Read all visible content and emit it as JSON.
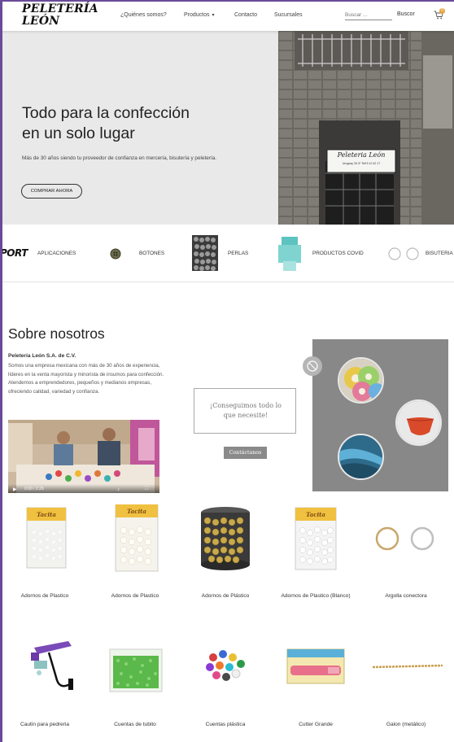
{
  "header": {
    "logo_line1": "PELETERÍA",
    "logo_line2": "LEÓN",
    "nav": {
      "about": "¿Quiénes somos?",
      "products": "Productos",
      "contact": "Contacto",
      "branches": "Sucursales"
    },
    "search": {
      "placeholder": "Buscar ...",
      "button": "Buscor"
    },
    "cart_count": "0"
  },
  "hero": {
    "title_line1": "Todo para la confección",
    "title_line2": "en un solo lugar",
    "subtitle": "Más de 30 años siendo tu proveedor de confianza en mercería, bisutería y peletería.",
    "cta": "COMPRAR AHORA",
    "sign_line1": "Peleteria León",
    "sign_line2": "Uruguay 30-3º Telf 5 10 42 17"
  },
  "categories": [
    {
      "label": "APLICACIONES",
      "badge_text": "PORT"
    },
    {
      "label": "BOTONES"
    },
    {
      "label": "PERLAS"
    },
    {
      "label": "PRODUCTOS COVID"
    },
    {
      "label": "BISUTERIA"
    }
  ],
  "about": {
    "title": "Sobre nosotros",
    "company": "Peletería León S.A. de C.V.",
    "text": "Somos una empresa mexicana con más de 30 años de experiencia, líderes en la venta mayorista y minorista de insumos para confección. Atendemos a emprendedores, pequeños y medianos empresas, ofreciendo calidad, variedad y confianza.",
    "video_time": "0:00 / 2:29",
    "quote": "¡Conseguimos todo lo que necesite!",
    "contact_button": "Contáctanos"
  },
  "products": [
    {
      "name": "Adornos de Plastico",
      "package_label": "Tacita"
    },
    {
      "name": "Adornos de Plastico",
      "package_label": "Tacita"
    },
    {
      "name": "Adornos de Plástico"
    },
    {
      "name": "Adornos de Plastico (Blanco)",
      "package_label": "Tacita"
    },
    {
      "name": "Argolla conectora"
    },
    {
      "name": "Cautin para pedreria"
    },
    {
      "name": "Cuentas de tubito"
    },
    {
      "name": "Cuentas plástica"
    },
    {
      "name": "Cutter Grande"
    },
    {
      "name": "Galon (metálico)"
    }
  ],
  "colors": {
    "hero_bg": "#e9e9e9",
    "panel_gray": "#888888",
    "accent_badge": "#e6a23c",
    "frame": "#6a4a9a"
  }
}
